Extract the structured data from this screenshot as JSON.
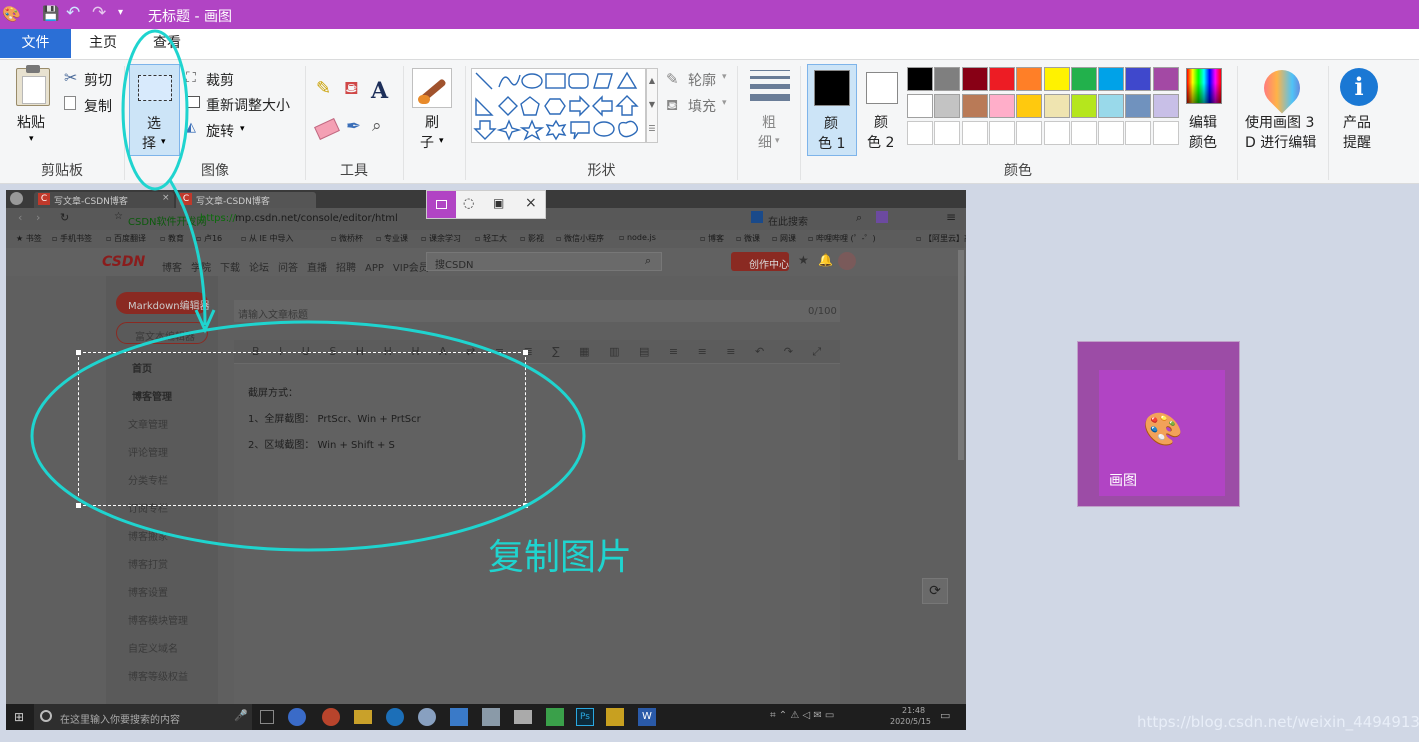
{
  "window": {
    "title": "无标题 - 画图"
  },
  "menu": {
    "file": "文件",
    "home": "主页",
    "view": "查看"
  },
  "ribbon": {
    "paste": "粘贴",
    "cut": "剪切",
    "copy": "复制",
    "clipboard_group": "剪贴板",
    "select_top": "选",
    "select_bottom": "择",
    "crop": "裁剪",
    "resize": "重新调整大小",
    "rotate": "旋转",
    "image_group": "图像",
    "tools_group": "工具",
    "brush_top": "刷",
    "brush_bottom": "子",
    "shapes_group": "形状",
    "outline": "轮廓",
    "fill": "填充",
    "size_top": "粗",
    "size_bottom": "细",
    "color1_top": "颜",
    "color1_bottom": "色 1",
    "color2_top": "颜",
    "color2_bottom": "色 2",
    "edit_colors_top": "编辑",
    "edit_colors_bottom": "颜色",
    "paint3d_top": "使用画图 3",
    "paint3d_bottom": "D 进行编辑",
    "alert_top": "产品",
    "alert_bottom": "提醒",
    "colors_group": "颜色"
  },
  "palette": {
    "row1": [
      "#000000",
      "#7f7f7f",
      "#880015",
      "#ed1c24",
      "#ff7f27",
      "#fff200",
      "#22b14c",
      "#00a2e8",
      "#3f48cc",
      "#a349a4"
    ],
    "row2": [
      "#ffffff",
      "#c3c3c3",
      "#b97a57",
      "#ffaec9",
      "#ffc90e",
      "#efe4b0",
      "#b5e61d",
      "#99d9ea",
      "#7092be",
      "#c8bfe7"
    ],
    "color1": "#000000",
    "color2": "#ffffff"
  },
  "browser": {
    "tab1": "写文章-CSDN博客",
    "tab2": "写文章-CSDN博客",
    "site_label": "CSDN软件开发网",
    "url_https": "https://",
    "url_rest": "mp.csdn.net/console/editor/html",
    "search_placeholder": "在此搜索",
    "bookmarks": [
      "书签",
      "手机书签",
      "百度翻译",
      "教育",
      "卢16",
      "从 IE 中导入",
      "微桥杯",
      "专业课",
      "课余学习",
      "轻工大",
      "影视",
      "微信小程序",
      "node.js",
      "博客",
      "微课",
      "网课",
      "哔哩哔哩 (゜-゜)",
      "【阿里云】高校学",
      "Windows 从零"
    ]
  },
  "csdn": {
    "logo": "CSDN",
    "nav": [
      "博客",
      "学院",
      "下载",
      "论坛",
      "问答",
      "直播",
      "招聘",
      "APP",
      "VIP会员"
    ],
    "search": "搜CSDN",
    "create": "创作中心",
    "btn_markdown": "Markdown编辑器",
    "btn_rich": "富文本编辑器",
    "title_placeholder": "请输入文章标题",
    "title_count": "0/100",
    "side_items": [
      "首页",
      "博客管理",
      "文章管理",
      "评论管理",
      "分类专栏",
      "订阅专栏",
      "博客搬家",
      "博客打赏",
      "博客设置",
      "博客模块管理",
      "自定义域名",
      "博客等级权益"
    ],
    "content": [
      "截屏方式：",
      "1、全屏截图：  PrtScr、Win + PrtScr",
      "2、区域截图：  Win + Shift + S"
    ]
  },
  "annotation": {
    "text": "复制图片"
  },
  "taskbar": {
    "search": "在这里输入你要搜索的内容",
    "time": "21:48",
    "date": "2020/5/15"
  },
  "tile": {
    "label": "画图"
  },
  "watermark": "https://blog.csdn.net/weixin_44949135"
}
